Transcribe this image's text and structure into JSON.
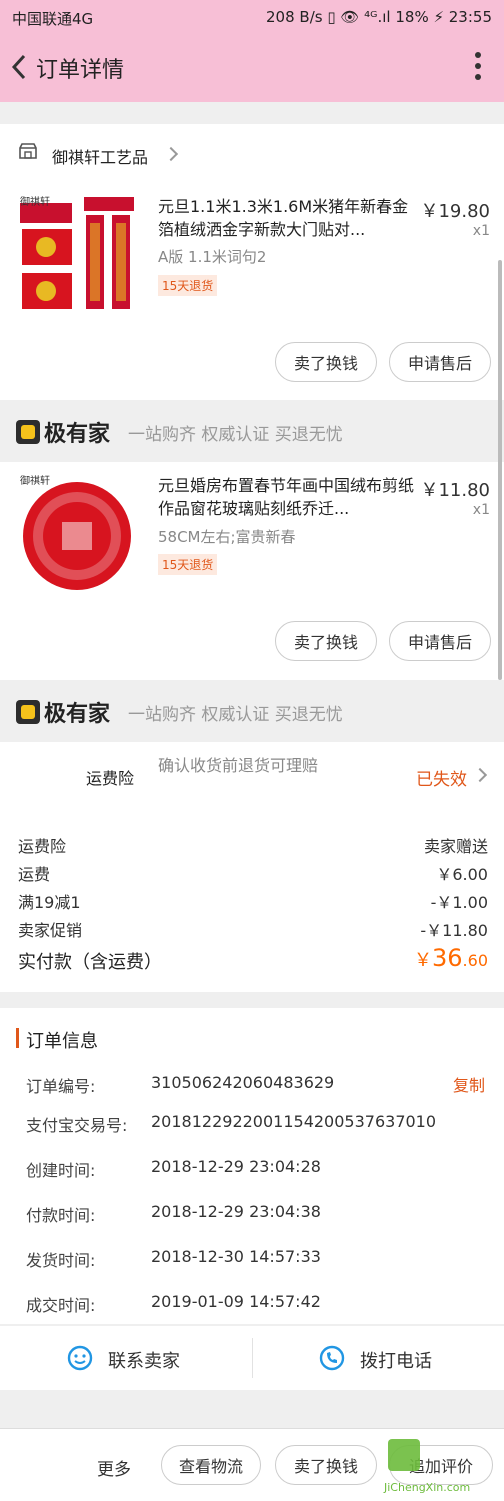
{
  "status_bar": {
    "carrier": "中国联通4G",
    "right": "208 B/s ▯ 👁 ⁴ᴳ.ıl 18% ⚡ 23:55"
  },
  "header": {
    "title": "订单详情"
  },
  "shop": {
    "name": "御祺轩工艺品"
  },
  "items": [
    {
      "title": "元旦1.1米1.3米1.6M米猪年新春金箔植绒洒金字新款大门贴对...",
      "variant": "A版 1.1米词句2",
      "tag": "15天退货",
      "price": "￥19.80",
      "qty": "x1",
      "btn_sell": "卖了换钱",
      "btn_after": "申请售后",
      "thumb_text": "御祺轩"
    },
    {
      "title": "元旦婚房布置春节年画中国绒布剪纸作品窗花玻璃贴刻纸乔迁...",
      "variant": "58CM左右;富贵新春",
      "tag": "15天退货",
      "price": "￥11.80",
      "qty": "x1",
      "btn_sell": "卖了换钱",
      "btn_after": "申请售后",
      "thumb_text": "御祺轩"
    }
  ],
  "brand": {
    "name": "极有家",
    "slogan": "一站购齐 权威认证 买退无忧"
  },
  "insurance": {
    "label": "运费险",
    "desc": "确认收货前退货可理赔",
    "status": "已失效"
  },
  "fees": [
    {
      "k": "运费险",
      "v": "卖家赠送"
    },
    {
      "k": "运费",
      "v": "￥6.00"
    },
    {
      "k": "满19减1",
      "v": "-￥1.00"
    },
    {
      "k": "卖家促销",
      "v": "-￥11.80"
    }
  ],
  "total": {
    "label": "实付款（含运费）",
    "currency": "￥",
    "int": "36",
    "dec": ".60"
  },
  "order_info": {
    "title": "订单信息",
    "copy": "复制",
    "rows": [
      {
        "k": "订单编号:",
        "v": "310506242060483629"
      },
      {
        "k": "支付宝交易号:",
        "v": "2018122922001154200537637010"
      },
      {
        "k": "创建时间:",
        "v": "2018-12-29 23:04:28"
      },
      {
        "k": "付款时间:",
        "v": "2018-12-29 23:04:38"
      },
      {
        "k": "发货时间:",
        "v": "2018-12-30 14:57:33"
      },
      {
        "k": "成交时间:",
        "v": "2019-01-09 14:57:42"
      }
    ]
  },
  "contact": {
    "seller": "联系卖家",
    "phone": "拨打电话"
  },
  "bottom": {
    "more": "更多",
    "logistics": "查看物流",
    "sell": "卖了换钱",
    "review": "追加评价"
  },
  "watermark": {
    "site": "JiChengXin.com"
  },
  "colors": {
    "header_bg": "#f7bfd6",
    "accent": "#e0571a",
    "price_accent": "#ff6a00"
  }
}
